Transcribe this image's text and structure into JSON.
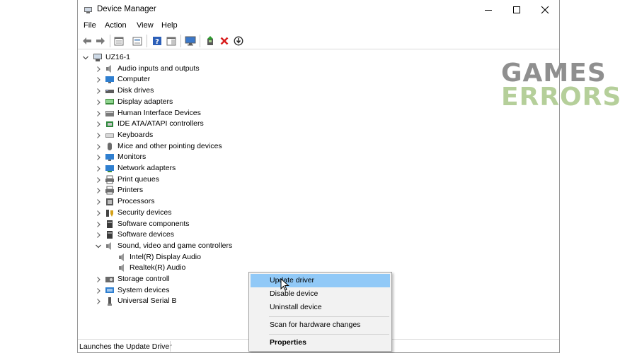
{
  "window": {
    "title": "Device Manager",
    "controls": {
      "minimize": "minimize-icon",
      "maximize": "maximize-icon",
      "close": "close-icon"
    }
  },
  "menu": [
    "File",
    "Action",
    "View",
    "Help"
  ],
  "toolbar": [
    "back-icon",
    "forward-icon",
    "properties-pane-icon",
    "details-icon",
    "help-icon",
    "show-hide-icon",
    "monitor-icon",
    "update-driver-icon",
    "uninstall-icon",
    "scan-icon"
  ],
  "tree": {
    "root": "UZ16-1",
    "categories": [
      {
        "label": "Audio inputs and outputs",
        "icon": "speaker-icon"
      },
      {
        "label": "Computer",
        "icon": "computer-icon"
      },
      {
        "label": "Disk drives",
        "icon": "disk-icon"
      },
      {
        "label": "Display adapters",
        "icon": "display-adapter-icon"
      },
      {
        "label": "Human Interface Devices",
        "icon": "hid-icon"
      },
      {
        "label": "IDE ATA/ATAPI controllers",
        "icon": "ide-icon"
      },
      {
        "label": "Keyboards",
        "icon": "keyboard-icon"
      },
      {
        "label": "Mice and other pointing devices",
        "icon": "mouse-icon"
      },
      {
        "label": "Monitors",
        "icon": "monitor-icon"
      },
      {
        "label": "Network adapters",
        "icon": "network-icon"
      },
      {
        "label": "Print queues",
        "icon": "printer-icon"
      },
      {
        "label": "Printers",
        "icon": "printer-icon"
      },
      {
        "label": "Processors",
        "icon": "processor-icon"
      },
      {
        "label": "Security devices",
        "icon": "security-icon"
      },
      {
        "label": "Software components",
        "icon": "software-icon"
      },
      {
        "label": "Software devices",
        "icon": "software-icon"
      },
      {
        "label": "Sound, video and game controllers",
        "icon": "speaker-icon",
        "expanded": true,
        "children": [
          "Intel(R) Display Audio",
          "Realtek(R) Audio"
        ]
      },
      {
        "label": "Storage controll",
        "icon": "storage-icon"
      },
      {
        "label": "System devices",
        "icon": "system-icon"
      },
      {
        "label": "Universal Serial B",
        "icon": "usb-icon"
      }
    ]
  },
  "context_menu": {
    "items": [
      "Update driver",
      "Disable device",
      "Uninstall device",
      "Scan for hardware changes",
      "Properties"
    ],
    "highlighted": "Update driver"
  },
  "status": "Launches the Update Driver",
  "watermark": {
    "line1": "GAMES",
    "line2": "ERRORS"
  },
  "colors": {
    "highlight": "#91c9f7",
    "watermark_gray": "#8f8f8f",
    "watermark_green": "#b5cf9a",
    "uninstall_red": "#d81e1e"
  }
}
